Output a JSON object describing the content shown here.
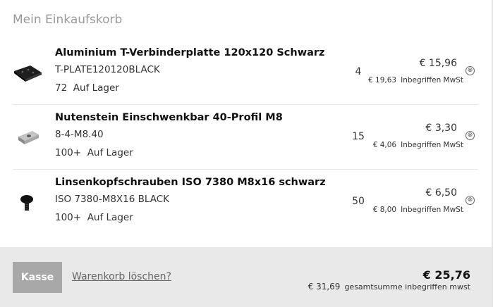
{
  "cart": {
    "title": "Mein Einkaufskorb",
    "items": [
      {
        "name": "Aluminium T-Verbinderplatte 120x120 Schwarz",
        "sku": "T-PLATE120120BLACK",
        "stock_count": "72",
        "stock_label": "Auf Lager",
        "quantity": "4",
        "price": "€ 15,96",
        "gross_price": "€  19,63",
        "gross_label": "Inbegriffen MwSt",
        "remove_icon": "⊗"
      },
      {
        "name": "Nutenstein Einschwenkbar 40-Profil M8",
        "sku": "8-4-M8.40",
        "stock_count": "100+",
        "stock_label": "Auf Lager",
        "quantity": "15",
        "price": "€ 3,30",
        "gross_price": "€  4,06",
        "gross_label": "Inbegriffen MwSt",
        "remove_icon": "⊗"
      },
      {
        "name": "Linsenkopfschrauben ISO 7380 M8x16 schwarz",
        "sku": "ISO 7380-M8X16 BLACK",
        "stock_count": "100+",
        "stock_label": "Auf Lager",
        "quantity": "50",
        "price": "€ 6,50",
        "gross_price": "€  8,00",
        "gross_label": "Inbegriffen MwSt",
        "remove_icon": "⊗"
      }
    ],
    "footer": {
      "checkout_label": "Kasse",
      "clear_label": "Warenkorb löschen?",
      "total": "€ 25,76",
      "total_gross": "€ 31,69",
      "total_gross_label": "gesamtsumme inbegriffen mwst"
    }
  }
}
